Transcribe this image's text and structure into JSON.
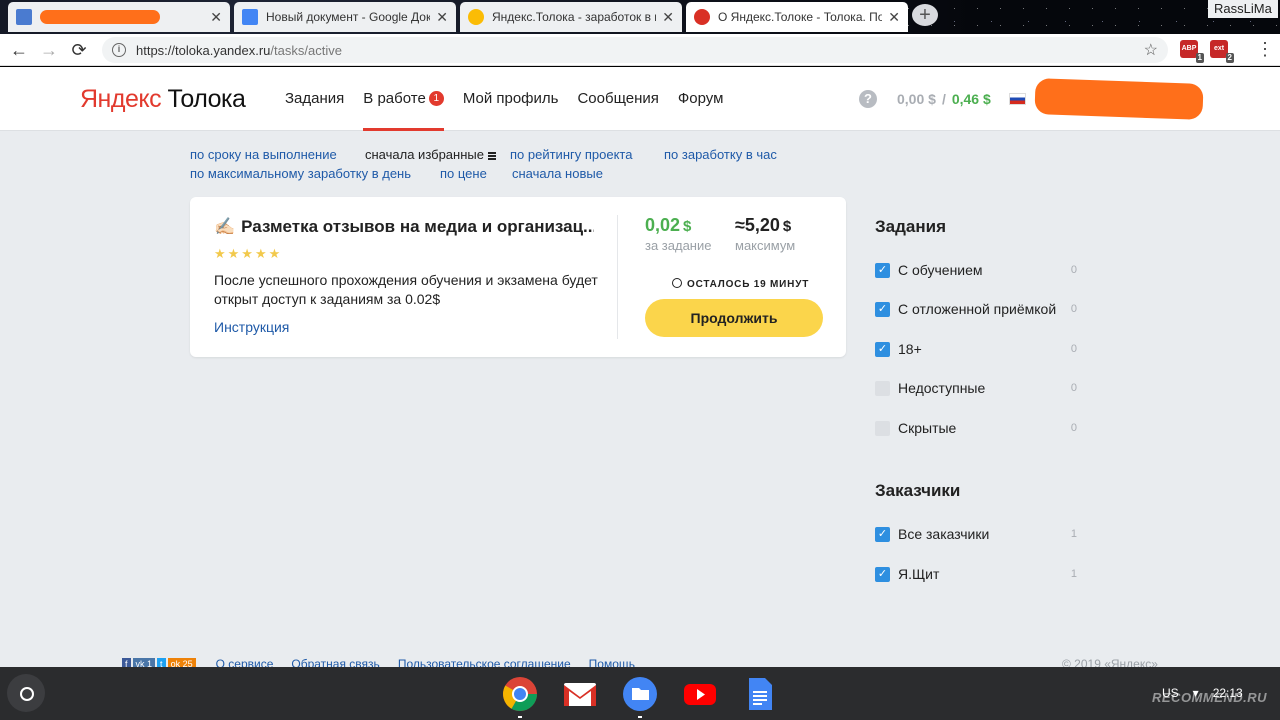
{
  "browser": {
    "tabs": [
      {
        "title": "",
        "favicon_color": "#4a7bd0",
        "redacted": true
      },
      {
        "title": "Новый документ - Google Док",
        "favicon_color": "#4285f4"
      },
      {
        "title": "Яндекс.Толока - заработок в и",
        "favicon_color": "#fbbc05"
      },
      {
        "title": "О Яндекс.Толоке - Толока. По",
        "favicon_color": "#d93025"
      }
    ],
    "close_glyph": "✕",
    "new_tab_glyph": "+",
    "window_user": "RassLiMa",
    "url_host": "https://toloka.yandex.ru",
    "url_path": "/tasks/active",
    "info_glyph": "i",
    "star_glyph": "☆",
    "back_glyph": "←",
    "forward_glyph": "→",
    "reload_glyph": "⟳",
    "extensions": [
      {
        "label": "ABP",
        "count": "1"
      },
      {
        "label": "ext",
        "count": "2"
      }
    ],
    "menu_glyph": "⋮"
  },
  "header": {
    "logo_ya": "Яндекс",
    "logo_rest": "Толока",
    "nav": [
      {
        "label": "Задания"
      },
      {
        "label": "В работе",
        "badge": "1",
        "active": true
      },
      {
        "label": "Мой профиль"
      },
      {
        "label": "Сообщения"
      },
      {
        "label": "Форум"
      }
    ],
    "help_glyph": "?",
    "balance_pending": "0,00 $",
    "balance_separator": "/",
    "balance_available": "0,46 $"
  },
  "sort_options": {
    "deadline": "по сроку на выполнение",
    "favorites_first": "сначала избранные",
    "project_rating": "по рейтингу проекта",
    "hourly_earning": "по заработку в час",
    "max_daily_earning": "по максимальному заработку в день",
    "price": "по цене",
    "newest_first": "сначала новые"
  },
  "task": {
    "icon": "✍🏻",
    "title": "Разметка отзывов на медиа и организац...",
    "stars": "★★★★★",
    "description": "После успешного прохождения обучения и экзамена будет открыт доступ к заданиям за 0.02$",
    "instruction_link": "Инструкция",
    "price_value": "0,02",
    "price_currency": "$",
    "price_label": "за задание",
    "max_value": "≈5,20",
    "max_currency": "$",
    "max_label": "максимум",
    "time_left": "ОСТАЛОСЬ 19 МИНУТ",
    "continue_button": "Продолжить"
  },
  "filters": {
    "tasks_heading": "Задания",
    "tasks": [
      {
        "label": "С обучением",
        "checked": true,
        "count": "0"
      },
      {
        "label": "С отложенной приёмкой",
        "checked": true,
        "count": "0"
      },
      {
        "label": "18+",
        "checked": true,
        "count": "0"
      },
      {
        "label": "Недоступные",
        "checked": false,
        "count": "0"
      },
      {
        "label": "Скрытые",
        "checked": false,
        "count": "0"
      }
    ],
    "requesters_heading": "Заказчики",
    "requesters": [
      {
        "label": "Все заказчики",
        "checked": true,
        "count": "1"
      },
      {
        "label": "Я.Щит",
        "checked": true,
        "count": "1"
      }
    ],
    "check_glyph": "✓"
  },
  "footer": {
    "social": [
      {
        "label": "f",
        "color": "#3b5998"
      },
      {
        "label": "vk",
        "count": "1",
        "color": "#4a76a8"
      },
      {
        "label": "t",
        "color": "#1da1f2"
      },
      {
        "label": "ok",
        "count": "25",
        "color": "#ee8208"
      }
    ],
    "links": [
      "О сервисе",
      "Обратная связь",
      "Пользовательское соглашение",
      "Помощь"
    ],
    "copyright": "© 2019 «Яндекс»"
  },
  "shelf": {
    "apps": [
      "chrome",
      "gmail",
      "files",
      "youtube",
      "docs"
    ],
    "locale": "US",
    "time": "22:13"
  },
  "watermark": "RECOMMEND.RU"
}
